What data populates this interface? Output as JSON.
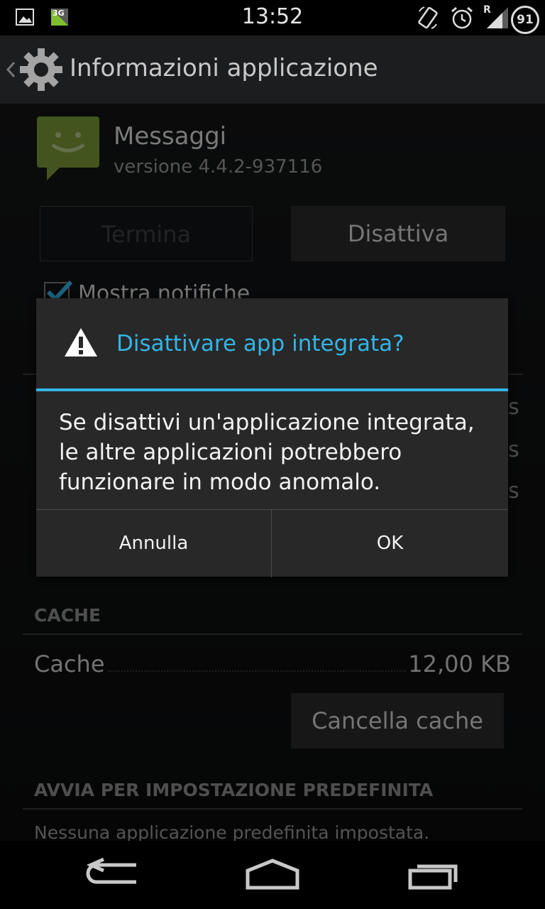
{
  "status_bar": {
    "time": "13:52",
    "network_type": "3G",
    "roaming": "R",
    "battery": "91",
    "icons": [
      "gallery-icon",
      "network-3g-icon",
      "screen-rotate-icon",
      "alarm-icon",
      "signal-icon",
      "battery-icon"
    ]
  },
  "action_bar": {
    "title": "Informazioni applicazione",
    "icon": "settings-gear-icon"
  },
  "app": {
    "name": "Messaggi",
    "version": "versione 4.4.2-937116",
    "icon": "messaging-app-icon",
    "icon_color": "#7d9a3a"
  },
  "buttons": {
    "terminate": "Termina",
    "disable": "Disattiva"
  },
  "notifications_checkbox": {
    "label": "Mostra notifiche",
    "checked": true
  },
  "cache_section": {
    "header": "CACHE",
    "label": "Cache",
    "value": "12,00 KB",
    "clear_button": "Cancella cache"
  },
  "default_section": {
    "header": "AVVIA PER IMPOSTAZIONE PREDEFINITA",
    "text": "Nessuna applicazione predefinita impostata."
  },
  "dialog": {
    "title": "Disattivare app integrata?",
    "message": "Se disattivi un'applicazione integrata, le altre applicazioni potrebbero funzionare in modo anomalo.",
    "cancel": "Annulla",
    "ok": "OK",
    "accent_color": "#33b5e5"
  },
  "nav_bar": {
    "icons": [
      "back-icon",
      "home-icon",
      "recent-apps-icon"
    ]
  }
}
